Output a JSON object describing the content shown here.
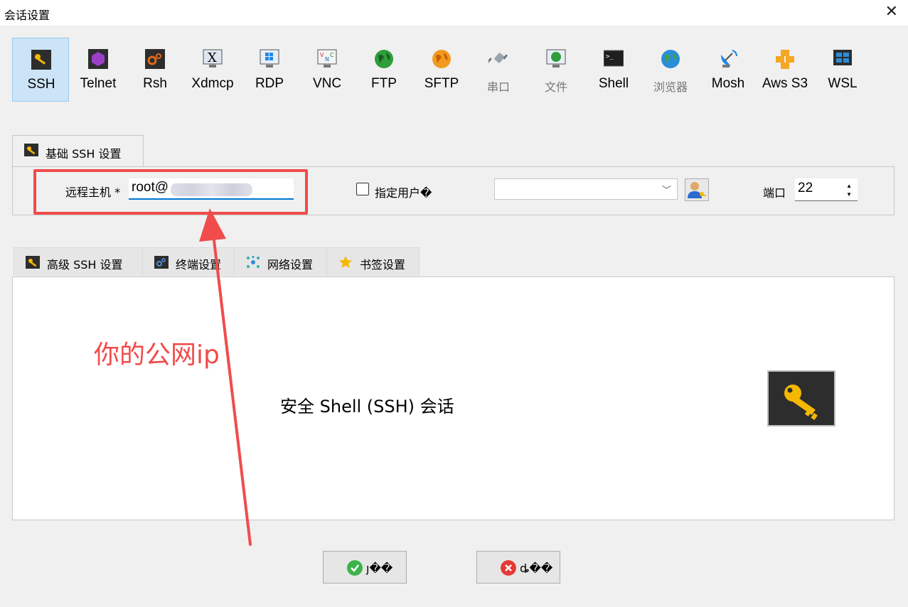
{
  "window": {
    "title": "会话设置"
  },
  "protocols": [
    {
      "label": "SSH",
      "icon": "key-icon",
      "selected": true
    },
    {
      "label": "Telnet",
      "icon": "telnet-icon"
    },
    {
      "label": "Rsh",
      "icon": "rsh-icon"
    },
    {
      "label": "Xdmcp",
      "icon": "xdmcp-icon"
    },
    {
      "label": "RDP",
      "icon": "rdp-icon"
    },
    {
      "label": "VNC",
      "icon": "vnc-icon"
    },
    {
      "label": "FTP",
      "icon": "ftp-globe-icon"
    },
    {
      "label": "SFTP",
      "icon": "sftp-globe-icon"
    },
    {
      "label": "串口",
      "icon": "serial-plug-icon"
    },
    {
      "label": "文件",
      "icon": "file-monitor-icon"
    },
    {
      "label": "Shell",
      "icon": "shell-terminal-icon"
    },
    {
      "label": "浏览器",
      "icon": "browser-globe-icon"
    },
    {
      "label": "Mosh",
      "icon": "mosh-dish-icon"
    },
    {
      "label": "Aws S3",
      "icon": "aws-s3-icon"
    },
    {
      "label": "WSL",
      "icon": "windows-icon"
    }
  ],
  "basic_tab": {
    "label": "基础 SSH 设置"
  },
  "basic": {
    "remote_host_label": "远程主机 *",
    "remote_host_value": "root@",
    "specify_user_label": "指定用户�",
    "specify_user_checked": false,
    "username_value": "",
    "port_label": "端口",
    "port_value": "22"
  },
  "lower_tabs": [
    {
      "label": "高级 SSH 设置",
      "icon": "key-icon"
    },
    {
      "label": "终端设置",
      "icon": "terminal-settings-icon"
    },
    {
      "label": "网络设置",
      "icon": "network-icon"
    },
    {
      "label": "书签设置",
      "icon": "star-icon"
    }
  ],
  "description": "安全 Shell (SSH) 会话",
  "annotation": {
    "text": "你的公网ip",
    "color": "#f04c4c"
  },
  "buttons": {
    "ok_label": "ȷ��",
    "cancel_label": "ȡ��"
  },
  "colors": {
    "accent": "#0078d4",
    "selected_bg": "#cce4f7",
    "annotation": "#f04c4c"
  }
}
